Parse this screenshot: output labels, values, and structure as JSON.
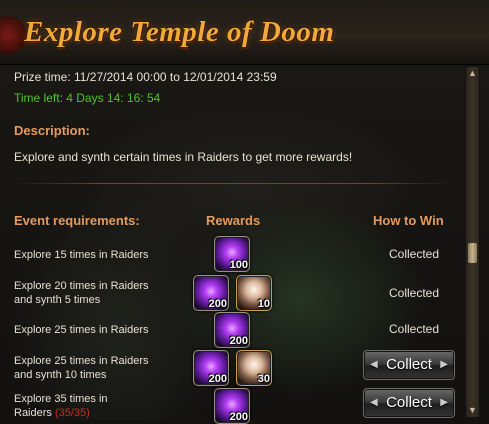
{
  "title": "Explore Temple of Doom",
  "prize_time": "Prize time: 11/27/2014 00:00 to 12/01/2014 23:59",
  "time_left": "Time left: 4 Days  14: 16: 54",
  "description_heading": "Description:",
  "description": "Explore and synth certain times in Raiders to get more rewards!",
  "columns": {
    "requirements": "Event requirements:",
    "rewards": "Rewards",
    "how_to_win": "How to Win"
  },
  "rows": [
    {
      "req_line1": "Explore 15 times in Raiders",
      "req_line2": "",
      "rewards": [
        {
          "icon": "purple-orb-icon",
          "qty": "100"
        }
      ],
      "status": "Collected"
    },
    {
      "req_line1": "Explore 20 times in Raiders",
      "req_line2": "and synth 5 times",
      "rewards": [
        {
          "icon": "purple-orb-icon",
          "qty": "200"
        },
        {
          "icon": "pearl-orb-icon",
          "qty": "10"
        }
      ],
      "status": "Collected"
    },
    {
      "req_line1": "Explore 25 times in Raiders",
      "req_line2": "",
      "rewards": [
        {
          "icon": "purple-orb-icon",
          "qty": "200"
        }
      ],
      "status": "Collected"
    },
    {
      "req_line1": "Explore 25 times in Raiders",
      "req_line2": "and synth 10 times",
      "rewards": [
        {
          "icon": "purple-orb-icon",
          "qty": "200"
        },
        {
          "icon": "pearl-orb-icon",
          "qty": "30"
        }
      ],
      "status": "Collect"
    },
    {
      "req_line1": "Explore 35 times in",
      "req_line2": "Raiders",
      "req_line2_progress": "(35/35)",
      "rewards": [
        {
          "icon": "purple-orb-icon",
          "qty": "200"
        }
      ],
      "status": "Collect"
    }
  ],
  "colors": {
    "title": "#f1a93a",
    "heading": "#e49a5c",
    "time_left": "#53c22a",
    "progress": "#cc2b1b"
  }
}
